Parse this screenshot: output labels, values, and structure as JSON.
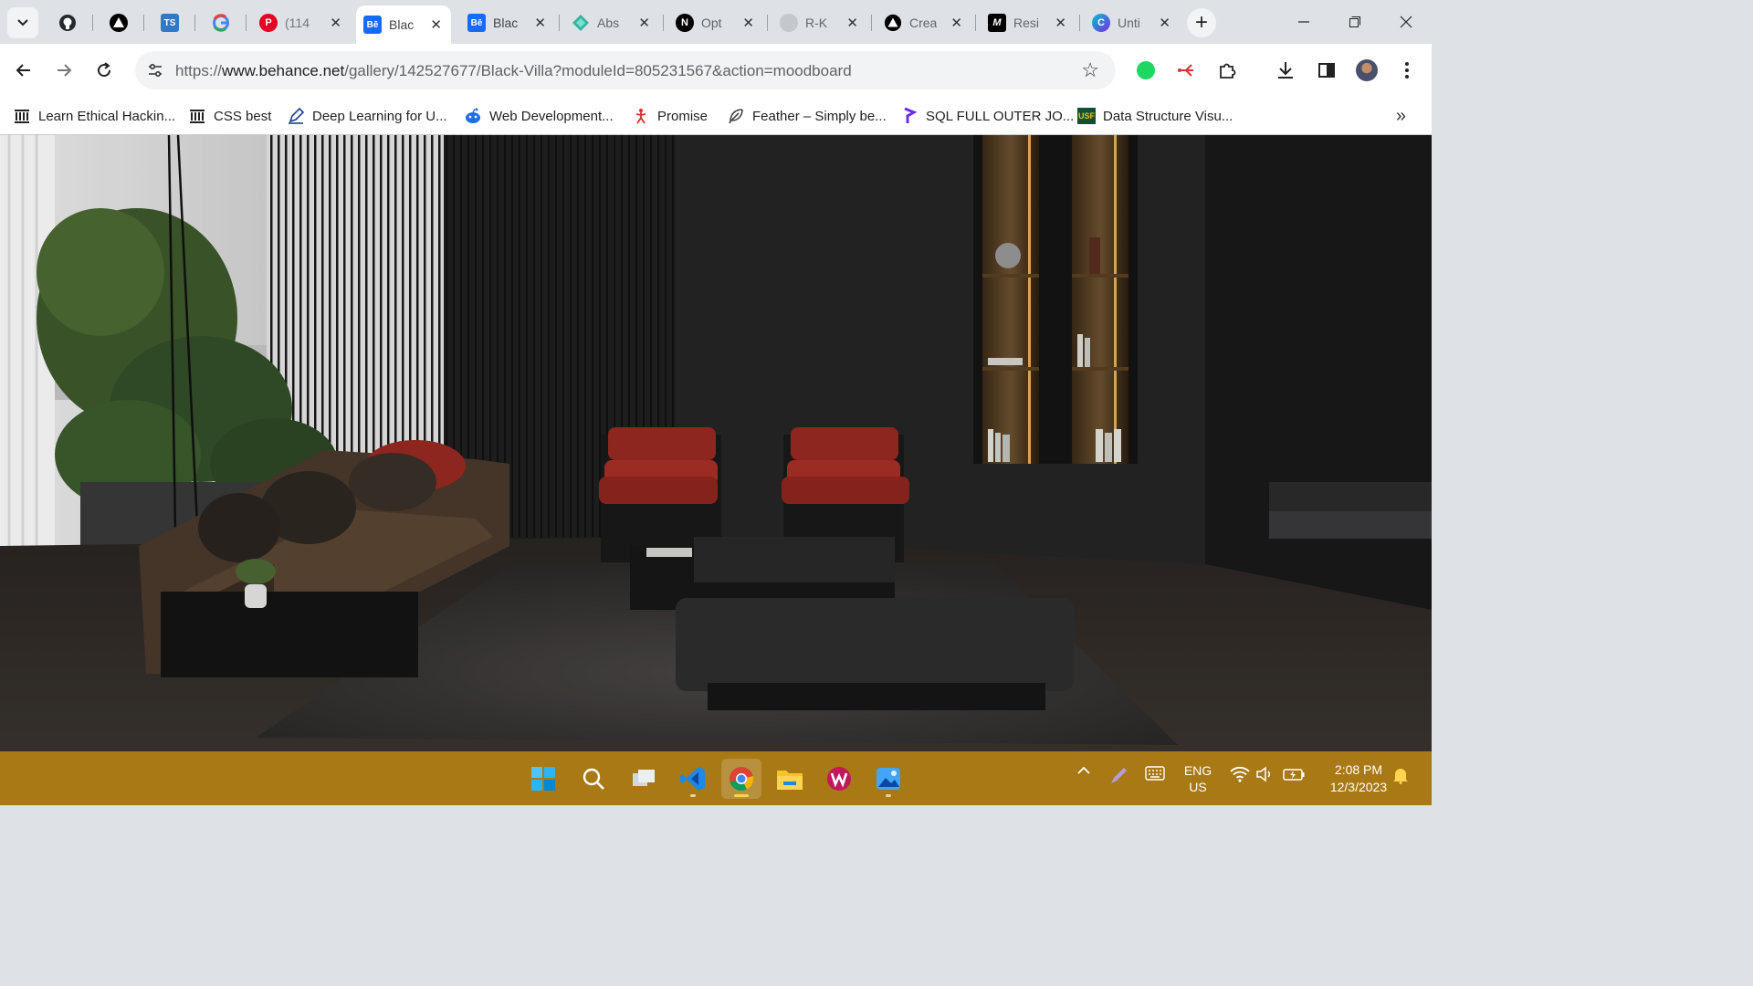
{
  "browser": {
    "tabs": [
      {
        "title": "",
        "icon": "github-icon"
      },
      {
        "title": "",
        "icon": "triangle-logo-icon"
      },
      {
        "title": "",
        "icon": "typescript-icon"
      },
      {
        "title": "",
        "icon": "google-icon"
      },
      {
        "title": "(114",
        "icon": "pinterest-icon"
      },
      {
        "title": "Blac",
        "icon": "behance-icon",
        "active": true
      },
      {
        "title": "Blac",
        "icon": "behance-icon"
      },
      {
        "title": "Abs",
        "icon": "diamond-icon"
      },
      {
        "title": "Opt",
        "icon": "notion-icon"
      },
      {
        "title": "R-K",
        "icon": "globe-icon"
      },
      {
        "title": "Crea",
        "icon": "triangle-logo-icon"
      },
      {
        "title": "Resi",
        "icon": "m-logo-icon"
      },
      {
        "title": "Unti",
        "icon": "canva-icon"
      }
    ],
    "address": {
      "scheme": "https://",
      "host": "www.behance.net",
      "path": "/gallery/142527677/Black-Villa?moduleId=805231567&action=moodboard"
    },
    "bookmarks": [
      {
        "label": "Learn Ethical Hackin...",
        "icon": "institution-icon"
      },
      {
        "label": "CSS best",
        "icon": "institution-icon"
      },
      {
        "label": "Deep Learning for U...",
        "icon": "pen-icon"
      },
      {
        "label": "Web Development...",
        "icon": "reddit-icon"
      },
      {
        "label": "Promise",
        "icon": "figure-icon"
      },
      {
        "label": "Feather – Simply be...",
        "icon": "feather-icon"
      },
      {
        "label": "SQL FULL OUTER JO...",
        "icon": "p-logo-icon"
      },
      {
        "label": "Data Structure Visu...",
        "icon": "usf-icon"
      }
    ]
  },
  "taskbar": {
    "language": {
      "line1": "ENG",
      "line2": "US"
    },
    "time": "2:08 PM",
    "date": "12/3/2023"
  },
  "colors": {
    "taskbar": "#a87914",
    "tabstrip": "#dee1e6",
    "behance": "#1769ff",
    "sofa_pillow_red": "#9a2a22"
  }
}
